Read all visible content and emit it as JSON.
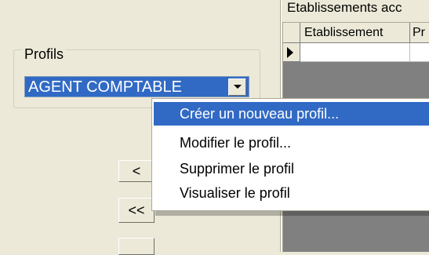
{
  "profils": {
    "group_label": "Profils",
    "selected_value": "AGENT COMPTABLE"
  },
  "buttons": {
    "move_left": "<",
    "move_all_left": "<<"
  },
  "grid": {
    "title": "Etablissements acc",
    "columns": [
      "Etablissement",
      "Pr"
    ]
  },
  "context_menu": {
    "items": [
      "Créer un nouveau profil...",
      "Modifier le profil...",
      "Supprimer le profil",
      "Visualiser le profil"
    ]
  },
  "colors": {
    "selection": "#316ac5",
    "window_bg": "#ece9d8"
  }
}
